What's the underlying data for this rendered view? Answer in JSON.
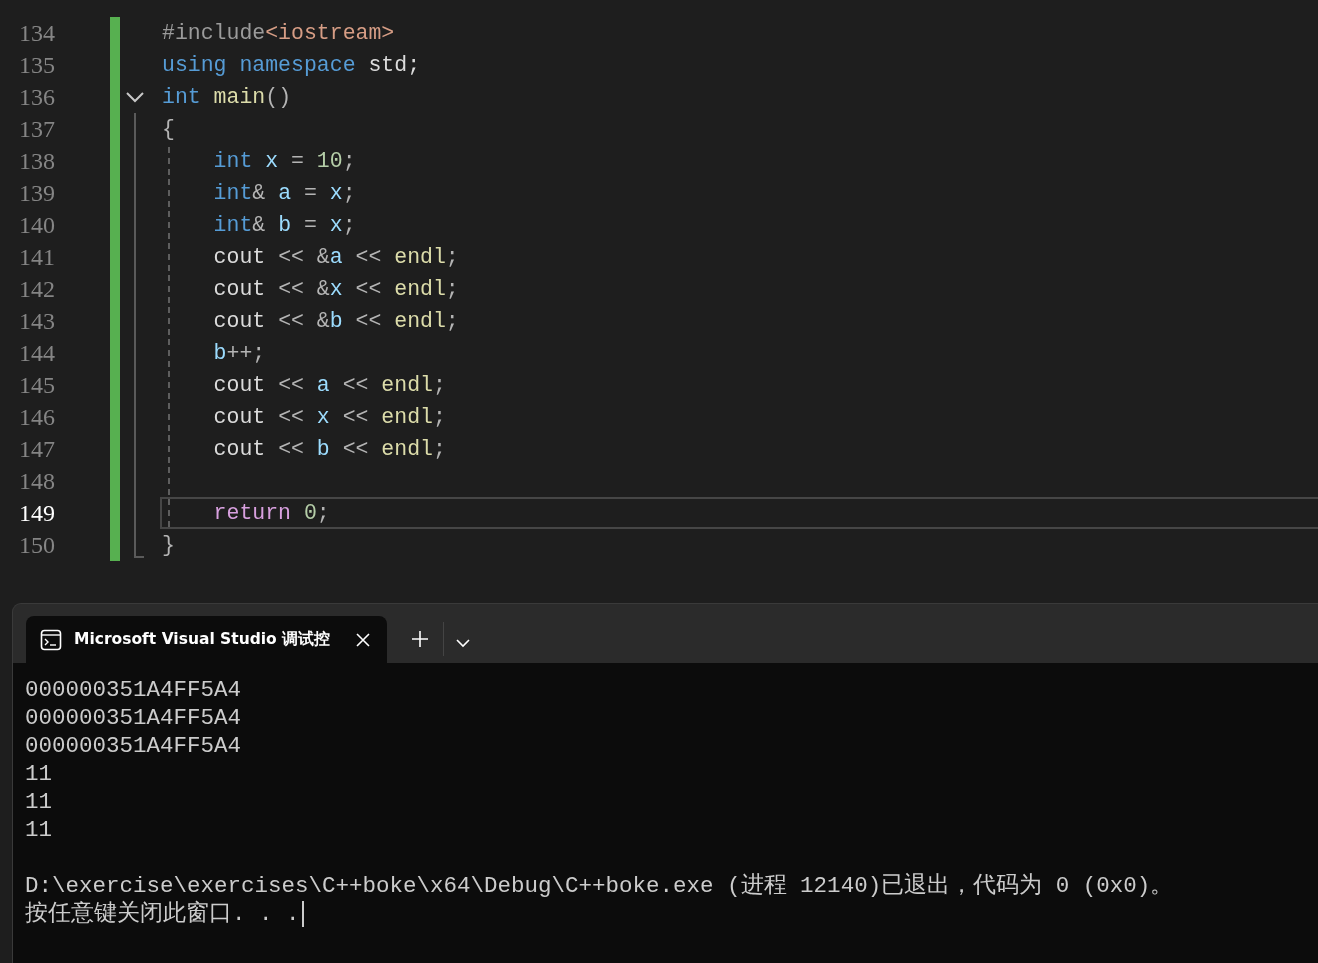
{
  "editor": {
    "lines": [
      {
        "number": "134",
        "selected": false,
        "changed": true,
        "tokens": [
          {
            "kind": "pre",
            "text": "#include"
          },
          {
            "kind": "str",
            "text": "<iostream>"
          }
        ]
      },
      {
        "number": "135",
        "selected": false,
        "changed": true,
        "tokens": [
          {
            "kind": "kw",
            "text": "using"
          },
          {
            "kind": "kw",
            "text": " namespace"
          },
          {
            "kind": "plain",
            "text": " std;"
          }
        ]
      },
      {
        "number": "136",
        "selected": false,
        "changed": true,
        "fold_open": true,
        "tokens": [
          {
            "kind": "kw",
            "text": "int"
          },
          {
            "kind": "func",
            "text": " main"
          },
          {
            "kind": "op",
            "text": "()"
          }
        ]
      },
      {
        "number": "137",
        "selected": false,
        "changed": true,
        "fold_guide": true,
        "tokens": [
          {
            "kind": "op",
            "text": "{"
          }
        ]
      },
      {
        "number": "138",
        "selected": false,
        "changed": true,
        "fold_guide": true,
        "indent_guide": true,
        "tokens": [
          {
            "kind": "kw",
            "text": "    int"
          },
          {
            "kind": "var",
            "text": " x"
          },
          {
            "kind": "op",
            "text": " = "
          },
          {
            "kind": "num",
            "text": "10"
          },
          {
            "kind": "op",
            "text": ";"
          }
        ]
      },
      {
        "number": "139",
        "selected": false,
        "changed": true,
        "fold_guide": true,
        "indent_guide": true,
        "tokens": [
          {
            "kind": "kw",
            "text": "    int"
          },
          {
            "kind": "op",
            "text": "& "
          },
          {
            "kind": "var",
            "text": "a"
          },
          {
            "kind": "op",
            "text": " = "
          },
          {
            "kind": "var",
            "text": "x"
          },
          {
            "kind": "op",
            "text": ";"
          }
        ]
      },
      {
        "number": "140",
        "selected": false,
        "changed": true,
        "fold_guide": true,
        "indent_guide": true,
        "tokens": [
          {
            "kind": "kw",
            "text": "    int"
          },
          {
            "kind": "op",
            "text": "& "
          },
          {
            "kind": "var",
            "text": "b"
          },
          {
            "kind": "op",
            "text": " = "
          },
          {
            "kind": "var",
            "text": "x"
          },
          {
            "kind": "op",
            "text": ";"
          }
        ]
      },
      {
        "number": "141",
        "selected": false,
        "changed": true,
        "fold_guide": true,
        "indent_guide": true,
        "tokens": [
          {
            "kind": "plain",
            "text": "    cout "
          },
          {
            "kind": "op",
            "text": "<< &"
          },
          {
            "kind": "var",
            "text": "a"
          },
          {
            "kind": "op",
            "text": " << "
          },
          {
            "kind": "func",
            "text": "endl"
          },
          {
            "kind": "op",
            "text": ";"
          }
        ]
      },
      {
        "number": "142",
        "selected": false,
        "changed": true,
        "fold_guide": true,
        "indent_guide": true,
        "tokens": [
          {
            "kind": "plain",
            "text": "    cout "
          },
          {
            "kind": "op",
            "text": "<< &"
          },
          {
            "kind": "var",
            "text": "x"
          },
          {
            "kind": "op",
            "text": " << "
          },
          {
            "kind": "func",
            "text": "endl"
          },
          {
            "kind": "op",
            "text": ";"
          }
        ]
      },
      {
        "number": "143",
        "selected": false,
        "changed": true,
        "fold_guide": true,
        "indent_guide": true,
        "tokens": [
          {
            "kind": "plain",
            "text": "    cout "
          },
          {
            "kind": "op",
            "text": "<< &"
          },
          {
            "kind": "var",
            "text": "b"
          },
          {
            "kind": "op",
            "text": " << "
          },
          {
            "kind": "func",
            "text": "endl"
          },
          {
            "kind": "op",
            "text": ";"
          }
        ]
      },
      {
        "number": "144",
        "selected": false,
        "changed": true,
        "fold_guide": true,
        "indent_guide": true,
        "tokens": [
          {
            "kind": "var",
            "text": "    b"
          },
          {
            "kind": "op",
            "text": "++;"
          }
        ]
      },
      {
        "number": "145",
        "selected": false,
        "changed": true,
        "fold_guide": true,
        "indent_guide": true,
        "tokens": [
          {
            "kind": "plain",
            "text": "    cout "
          },
          {
            "kind": "op",
            "text": "<< "
          },
          {
            "kind": "var",
            "text": "a"
          },
          {
            "kind": "op",
            "text": " << "
          },
          {
            "kind": "func",
            "text": "endl"
          },
          {
            "kind": "op",
            "text": ";"
          }
        ]
      },
      {
        "number": "146",
        "selected": false,
        "changed": true,
        "fold_guide": true,
        "indent_guide": true,
        "tokens": [
          {
            "kind": "plain",
            "text": "    cout "
          },
          {
            "kind": "op",
            "text": "<< "
          },
          {
            "kind": "var",
            "text": "x"
          },
          {
            "kind": "op",
            "text": " << "
          },
          {
            "kind": "func",
            "text": "endl"
          },
          {
            "kind": "op",
            "text": ";"
          }
        ]
      },
      {
        "number": "147",
        "selected": false,
        "changed": true,
        "fold_guide": true,
        "indent_guide": true,
        "tokens": [
          {
            "kind": "plain",
            "text": "    cout "
          },
          {
            "kind": "op",
            "text": "<< "
          },
          {
            "kind": "var",
            "text": "b"
          },
          {
            "kind": "op",
            "text": " << "
          },
          {
            "kind": "func",
            "text": "endl"
          },
          {
            "kind": "op",
            "text": ";"
          }
        ]
      },
      {
        "number": "148",
        "selected": false,
        "changed": true,
        "fold_guide": true,
        "indent_guide": true
      },
      {
        "number": "149",
        "selected": true,
        "changed": true,
        "fold_guide": true,
        "indent_guide": true,
        "tokens": [
          {
            "kind": "ctrl",
            "text": "    return"
          },
          {
            "kind": "num",
            "text": " 0"
          },
          {
            "kind": "op",
            "text": ";"
          }
        ]
      },
      {
        "number": "150",
        "selected": false,
        "changed": true,
        "fold_end": true,
        "tokens": [
          {
            "kind": "op",
            "text": "}"
          }
        ]
      }
    ]
  },
  "terminal": {
    "tab": {
      "title": "Microsoft Visual Studio 调试控",
      "selected": true
    },
    "output": [
      "000000351A4FF5A4",
      "000000351A4FF5A4",
      "000000351A4FF5A4",
      "11",
      "11",
      "11"
    ],
    "exit_message": "D:\\exercise\\exercises\\C++boke\\x64\\Debug\\C++boke.exe (进程 12140)已退出，代码为 0 (0x0)。",
    "prompt": "按任意键关闭此窗口. . .",
    "cursor": true
  }
}
